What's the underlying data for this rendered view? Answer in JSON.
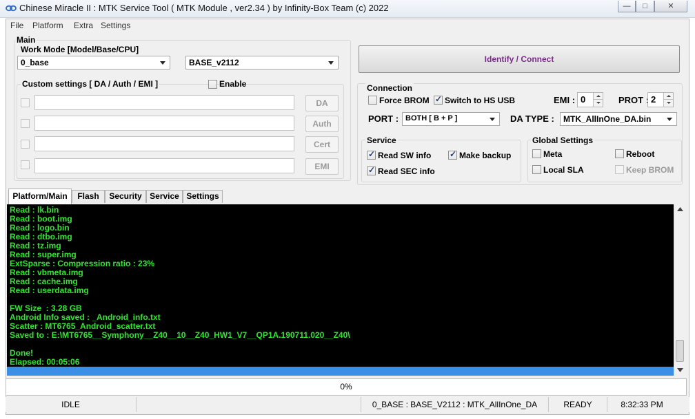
{
  "window": {
    "title": "Chinese Miracle II : MTK Service Tool ( MTK Module , ver2.34  ) by Infinity-Box Team (c) 2022",
    "minimize_glyph": "—",
    "maximize_glyph": "□",
    "close_glyph": "✕"
  },
  "menu": [
    "File",
    "Platform",
    "Extra",
    "Settings"
  ],
  "main": {
    "title": "Main",
    "work_mode_label": "Work Mode [Model/Base/CPU]",
    "work_mode_value": "0_base",
    "base_value": "BASE_v2112",
    "custom_label": "Custom settings [ DA / Auth / EMI ]",
    "enable_label": "Enable",
    "enable_checked": false,
    "custom_rows": [
      {
        "button": "DA",
        "value": ""
      },
      {
        "button": "Auth",
        "value": ""
      },
      {
        "button": "Cert",
        "value": ""
      },
      {
        "button": "EMI",
        "value": ""
      }
    ]
  },
  "identify_button": "Identify / Connect",
  "connection": {
    "title": "Connection",
    "force_brom_label": "Force BROM",
    "force_brom_checked": false,
    "hs_usb_label": "Switch to HS USB",
    "hs_usb_checked": true,
    "emi_label": "EMI :",
    "emi_value": "0",
    "prot_label": "PROT :",
    "prot_value": "2",
    "port_label": "PORT :",
    "port_value": "BOTH [ B + P ]",
    "da_type_label": "DA TYPE :",
    "da_type_value": "MTK_AllInOne_DA.bin"
  },
  "service": {
    "title": "Service",
    "read_sw_label": "Read SW info",
    "read_sw_checked": true,
    "make_backup_label": "Make backup",
    "make_backup_checked": true,
    "read_sec_label": "Read SEC info",
    "read_sec_checked": true
  },
  "global_settings": {
    "title": "Global Settings",
    "meta_label": "Meta",
    "reboot_label": "Reboot",
    "local_sla_label": "Local SLA",
    "keep_brom_label": "Keep BROM"
  },
  "tabs": [
    "Platform/Main",
    "Flash",
    "Security",
    "Service",
    "Settings"
  ],
  "active_tab": "Platform/Main",
  "log": [
    "Read : lk.bin",
    "Read : boot.img",
    "Read : logo.bin",
    "Read : dtbo.img",
    "Read : tz.img",
    "Read : super.img",
    "ExtSparse : Compression ratio : 23%",
    "Read : vbmeta.img",
    "Read : cache.img",
    "Read : userdata.img",
    "",
    "FW Size  : 3.28 GB",
    "Android Info saved : _Android_info.txt",
    "Scatter : MT6765_Android_scatter.txt",
    "Saved to : E:\\MT6765__Symphony__Z40__10__Z40_HW1_V7__QP1A.190711.020__Z40\\",
    "",
    "Done!",
    "Elapsed: 00:05:06"
  ],
  "log_color": "#2ee62e",
  "progress": {
    "text": "0%",
    "value": 0
  },
  "status": {
    "state": "IDLE",
    "config": "0_BASE : BASE_V2112 : MTK_AllInOne_DA",
    "ready": "READY",
    "time": "8:32:33 PM"
  }
}
